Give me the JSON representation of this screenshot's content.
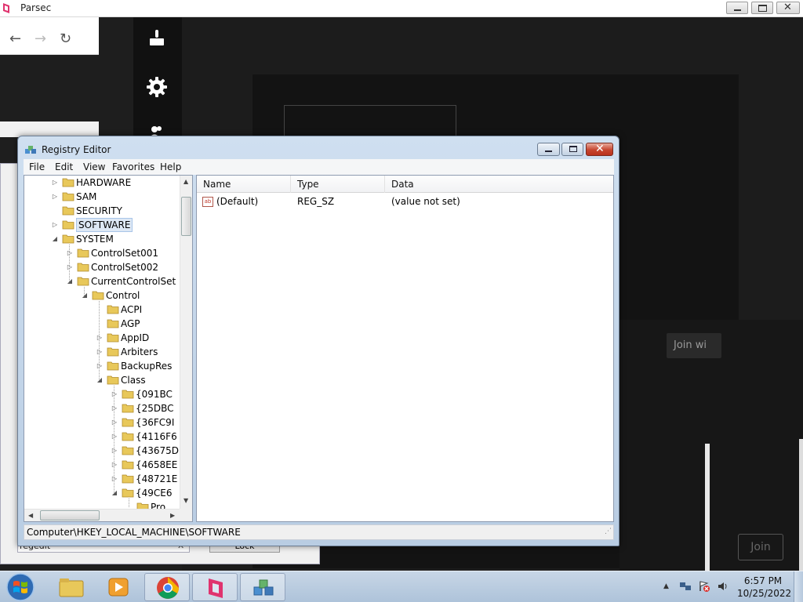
{
  "parsec": {
    "title": "Parsec",
    "join_with_label": "Join wi",
    "join_label": "Join"
  },
  "background_dialog": {
    "input_value": "regedit",
    "button_label": "Lock"
  },
  "regedit": {
    "title": "Registry Editor",
    "menu": [
      "File",
      "Edit",
      "View",
      "Favorites",
      "Help"
    ],
    "tree": [
      {
        "label": "HARDWARE",
        "level": 0,
        "expander": "collapsed"
      },
      {
        "label": "SAM",
        "level": 0,
        "expander": "collapsed"
      },
      {
        "label": "SECURITY",
        "level": 0,
        "expander": "none"
      },
      {
        "label": "SOFTWARE",
        "level": 0,
        "expander": "collapsed",
        "selected": true
      },
      {
        "label": "SYSTEM",
        "level": 0,
        "expander": "expanded"
      },
      {
        "label": "ControlSet001",
        "level": 1,
        "expander": "collapsed"
      },
      {
        "label": "ControlSet002",
        "level": 1,
        "expander": "collapsed"
      },
      {
        "label": "CurrentControlSet",
        "level": 1,
        "expander": "expanded"
      },
      {
        "label": "Control",
        "level": 2,
        "expander": "expanded"
      },
      {
        "label": "ACPI",
        "level": 3,
        "expander": "none"
      },
      {
        "label": "AGP",
        "level": 3,
        "expander": "none"
      },
      {
        "label": "AppID",
        "level": 3,
        "expander": "collapsed"
      },
      {
        "label": "Arbiters",
        "level": 3,
        "expander": "collapsed"
      },
      {
        "label": "BackupRes",
        "level": 3,
        "expander": "collapsed"
      },
      {
        "label": "Class",
        "level": 3,
        "expander": "expanded"
      },
      {
        "label": "{091BC",
        "level": 4,
        "expander": "collapsed"
      },
      {
        "label": "{25DBC",
        "level": 4,
        "expander": "collapsed"
      },
      {
        "label": "{36FC9I",
        "level": 4,
        "expander": "collapsed"
      },
      {
        "label": "{4116F6",
        "level": 4,
        "expander": "collapsed"
      },
      {
        "label": "{43675D",
        "level": 4,
        "expander": "collapsed"
      },
      {
        "label": "{4658EE",
        "level": 4,
        "expander": "collapsed"
      },
      {
        "label": "{48721E",
        "level": 4,
        "expander": "collapsed"
      },
      {
        "label": "{49CE6",
        "level": 4,
        "expander": "expanded"
      },
      {
        "label": "Pro",
        "level": 5,
        "expander": "none"
      }
    ],
    "columns": {
      "name": "Name",
      "type": "Type",
      "data": "Data"
    },
    "values": [
      {
        "name": "(Default)",
        "type": "REG_SZ",
        "data": "(value not set)",
        "icon": "ab"
      }
    ],
    "status_path": "Computer\\HKEY_LOCAL_MACHINE\\SOFTWARE"
  },
  "taskbar": {
    "time": "6:57 PM",
    "date": "10/25/2022"
  },
  "colors": {
    "folder": "#e8c85a",
    "selection": "#dde8f5",
    "close_button": "#c6452f"
  }
}
